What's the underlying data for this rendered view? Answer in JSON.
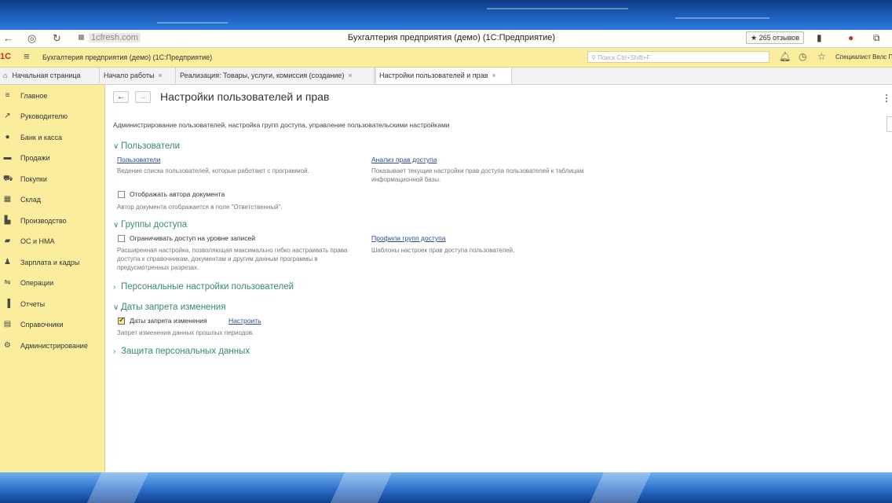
{
  "browser": {
    "url": "1cfresh.com",
    "title": "Бухгалтерия предприятия (демо) (1С:Предприятие)",
    "reviews": "★ 265 отзывов"
  },
  "app": {
    "logo": "1С",
    "title": "Бухгалтерия предприятия (демо) (1С:Предприятие)",
    "search_placeholder": "Поиск Ctrl+Shift+F",
    "user": "Специалист Велс П"
  },
  "tabs": [
    {
      "label": "Начальная страница"
    },
    {
      "label": "Начало работы"
    },
    {
      "label": "Реализация: Товары, услуги, комиссия (создание)"
    },
    {
      "label": "Настройки пользователей и прав"
    }
  ],
  "sidebar": {
    "items": [
      {
        "label": "Главное",
        "icon": "menu-icon"
      },
      {
        "label": "Руководителю",
        "icon": "trend-icon"
      },
      {
        "label": "Банк и касса",
        "icon": "coin-icon"
      },
      {
        "label": "Продажи",
        "icon": "briefcase-icon"
      },
      {
        "label": "Покупки",
        "icon": "cart-icon"
      },
      {
        "label": "Склад",
        "icon": "warehouse-icon"
      },
      {
        "label": "Производство",
        "icon": "factory-icon"
      },
      {
        "label": "ОС и НМА",
        "icon": "truck-icon"
      },
      {
        "label": "Зарплата и кадры",
        "icon": "person-icon"
      },
      {
        "label": "Операции",
        "icon": "operations-icon"
      },
      {
        "label": "Отчеты",
        "icon": "chart-icon"
      },
      {
        "label": "Справочники",
        "icon": "book-icon"
      },
      {
        "label": "Администрирование",
        "icon": "gear-icon"
      }
    ]
  },
  "page": {
    "title": "Настройки пользователей и прав",
    "description": "Администрирование пользователей, настройка групп доступа, управление пользовательскими настройками",
    "users": {
      "header": "Пользователи",
      "users_link": "Пользователи",
      "users_note": "Ведение списка пользователей, которые работают с программой.",
      "access_link": "Анализ прав доступа",
      "access_note": "Показывает текущие настройки прав доступа пользователей к таблицам информационной базы.",
      "author_checkbox": "Отображать автора документа",
      "author_note": "Автор документа отображается в поле \"Ответственный\"."
    },
    "groups": {
      "header": "Группы доступа",
      "restrict_checkbox": "Ограничивать доступ на уровне записей",
      "restrict_note": "Расширенная настройка, позволяющая максимально гибко настраивать права доступа к справочникам, документам и другим данным программы в предусмотренных разрезах.",
      "profiles_link": "Профили групп доступа",
      "profiles_note": "Шаблоны настроек прав доступа пользователей."
    },
    "personal": {
      "header": "Персональные настройки пользователей"
    },
    "dates": {
      "header": "Даты запрета изменения",
      "checkbox": "Даты запрета изменения",
      "checked": true,
      "configure_link": "Настроить",
      "note": "Запрет изменения данных прошлых периодов."
    },
    "personal_data": {
      "header": "Защита персональных данных"
    }
  }
}
